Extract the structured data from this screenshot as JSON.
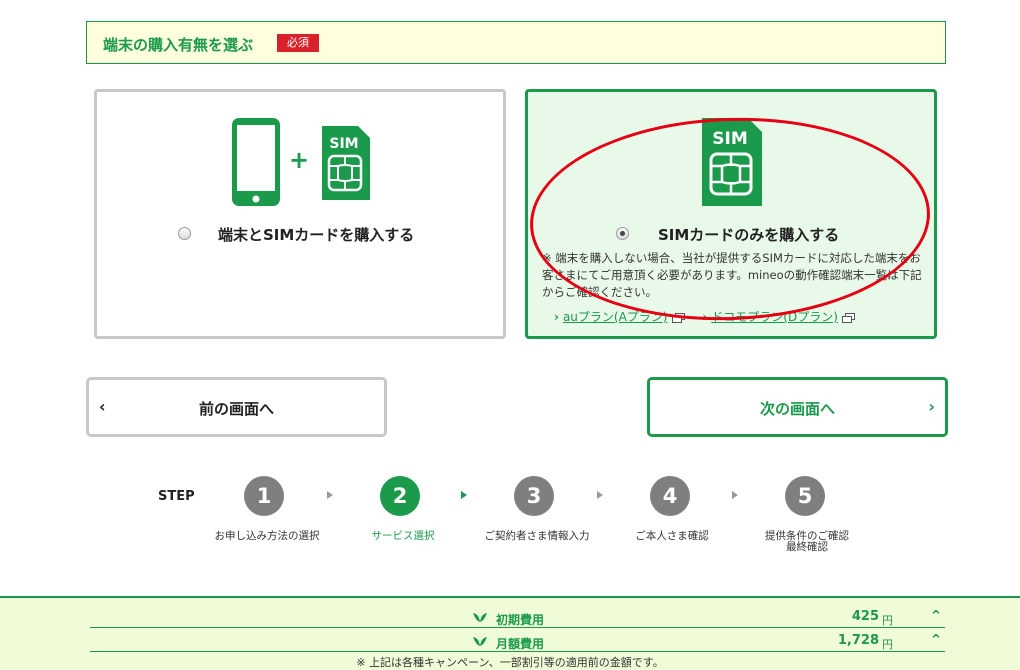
{
  "section": {
    "title": "端末の購入有無を選ぶ",
    "required": "必須"
  },
  "options": {
    "left": {
      "label": "端末とSIMカードを購入する",
      "checked": false,
      "plus": "+"
    },
    "right": {
      "label": "SIMカードのみを購入する",
      "checked": true,
      "note": "※ 端末を購入しない場合、当社が提供するSIMカードに対応した端末をお客さまにてご用意頂く必要があります。mineoの動作確認端末一覧は下記からご確認ください。",
      "links": [
        "auプラン(Aプラン)",
        "ドコモプラン(Dプラン)"
      ]
    },
    "sim_text": "SIM"
  },
  "nav": {
    "prev": "前の画面へ",
    "next": "次の画面へ",
    "prev_arrow": "‹",
    "next_arrow": "›"
  },
  "steps": {
    "title": "STEP",
    "items": [
      {
        "num": "1",
        "label": "お申し込み方法の選択"
      },
      {
        "num": "2",
        "label": "サービス選択"
      },
      {
        "num": "3",
        "label": "ご契約者さま情報入力"
      },
      {
        "num": "4",
        "label": "ご本人さま確認"
      },
      {
        "num": "5",
        "label": "提供条件のご確認\n最終確認"
      }
    ],
    "current": 2
  },
  "fees": {
    "rows": [
      {
        "name": "初期費用",
        "value": "425",
        "unit": "円"
      },
      {
        "name": "月額費用",
        "value": "1,728",
        "unit": "円"
      }
    ],
    "toggle": "^",
    "note": "※ 上記は各種キャンペーン、一部割引等の適用前の金額です。"
  },
  "colors": {
    "brand_green": "#1a9a4a",
    "required_red": "#d7222b",
    "annotation_red": "#e60012"
  }
}
